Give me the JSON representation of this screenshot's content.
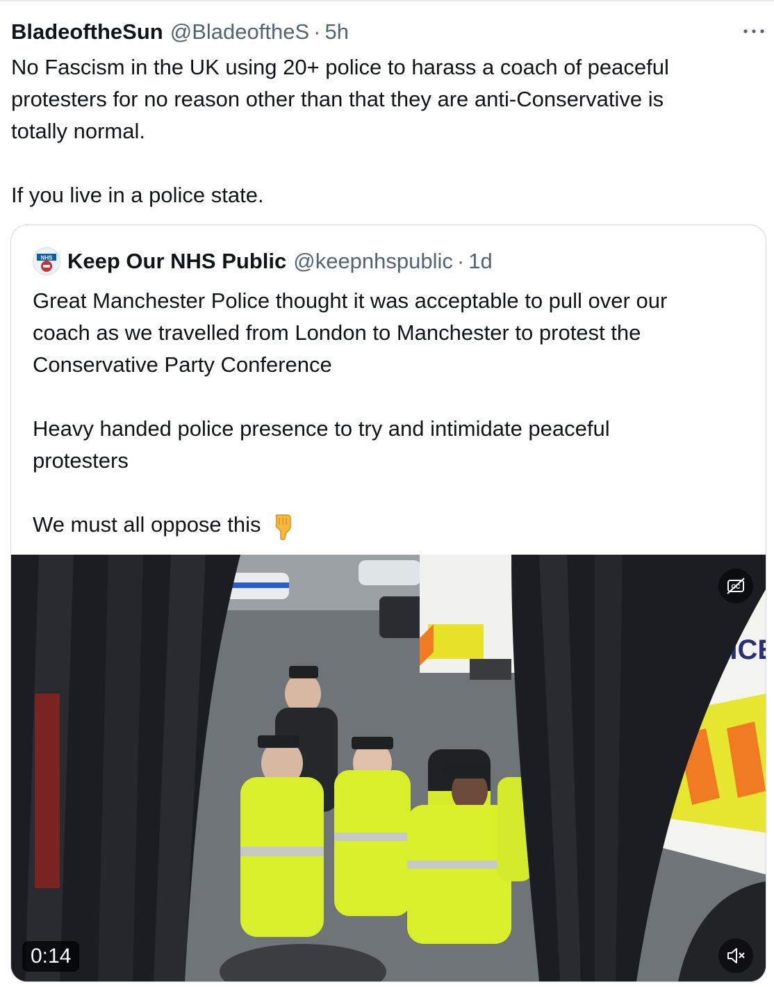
{
  "tweet": {
    "display_name": "BladeoftheSun",
    "handle": "@BladeoftheS",
    "separator": "·",
    "time": "5h",
    "more_icon": "ellipsis-icon",
    "text_lines": [
      "No Fascism in the UK using 20+ police to harass a coach of peaceful",
      "protesters for no reason other than that they are anti-Conservative is",
      "totally normal.",
      "If you live in a police state."
    ]
  },
  "quote": {
    "avatar_icon": "nhs-logo-avatar",
    "display_name": "Keep Our NHS Public",
    "handle": "@keepnhspublic",
    "separator": "·",
    "time": "1d",
    "text_lines": [
      "Great Manchester Police thought it was acceptable to pull over our",
      "coach as we travelled from London to Manchester to protest the",
      "Conservative Party Conference",
      "Heavy handed police presence to try and intimidate peaceful",
      "protesters",
      "We must all oppose this"
    ],
    "emoji_icon": "backhand-index-pointing-down-icon",
    "video": {
      "duration": "0:14",
      "cc_icon": "closed-captions-off-icon",
      "mute_icon": "muted-speaker-icon"
    }
  },
  "colors": {
    "text_primary": "#0f1419",
    "text_secondary": "#536471",
    "border": "#cfd9de"
  }
}
